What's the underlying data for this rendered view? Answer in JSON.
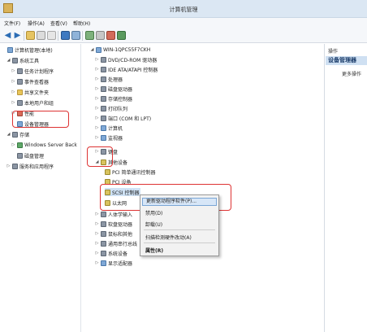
{
  "window": {
    "title": "计算机管理"
  },
  "menu": [
    "文件(F)",
    "操作(A)",
    "查看(V)",
    "帮助(H)"
  ],
  "left_tree": [
    {
      "label": "计算机管理(本地)",
      "icon": "computer-icon",
      "indent": 0,
      "arrow": ""
    },
    {
      "label": "系统工具",
      "icon": "tools-icon",
      "indent": 1,
      "arrow": "◢"
    },
    {
      "label": "任务计划程序",
      "icon": "clock-icon",
      "indent": 2,
      "arrow": "▷"
    },
    {
      "label": "事件查看器",
      "icon": "event-icon",
      "indent": 2,
      "arrow": "▷"
    },
    {
      "label": "共享文件夹",
      "icon": "folder-icon",
      "indent": 2,
      "arrow": "▷"
    },
    {
      "label": "本地用户和组",
      "icon": "users-icon",
      "indent": 2,
      "arrow": "▷"
    },
    {
      "label": "性能",
      "icon": "performance-icon",
      "indent": 2,
      "arrow": "▷"
    },
    {
      "label": "设备管理器",
      "icon": "device-manager-icon",
      "indent": 2,
      "arrow": ""
    },
    {
      "label": "存储",
      "icon": "storage-icon",
      "indent": 1,
      "arrow": "◢"
    },
    {
      "label": "Windows Server Back",
      "icon": "backup-icon",
      "indent": 2,
      "arrow": "▷"
    },
    {
      "label": "磁盘管理",
      "icon": "disk-icon",
      "indent": 2,
      "arrow": ""
    },
    {
      "label": "服务和应用程序",
      "icon": "services-icon",
      "indent": 1,
      "arrow": "▷"
    }
  ],
  "device_tree": [
    {
      "label": "WIN-1QPC55F7CKH",
      "icon": "computer-icon",
      "indent": 0,
      "arrow": "◢"
    },
    {
      "label": "DVD/CD-ROM 驱动器",
      "icon": "dvd-icon",
      "indent": 1,
      "arrow": "▷"
    },
    {
      "label": "IDE ATA/ATAPI 控制器",
      "icon": "ide-icon",
      "indent": 1,
      "arrow": "▷"
    },
    {
      "label": "处理器",
      "icon": "cpu-icon",
      "indent": 1,
      "arrow": "▷"
    },
    {
      "label": "磁盘驱动器",
      "icon": "disk-icon",
      "indent": 1,
      "arrow": "▷"
    },
    {
      "label": "存储控制器",
      "icon": "storage-controller-icon",
      "indent": 1,
      "arrow": "▷"
    },
    {
      "label": "打印队列",
      "icon": "printer-icon",
      "indent": 1,
      "arrow": "▷"
    },
    {
      "label": "端口 (COM 和 LPT)",
      "icon": "port-icon",
      "indent": 1,
      "arrow": "▷"
    },
    {
      "label": "计算机",
      "icon": "computer-icon",
      "indent": 1,
      "arrow": "▷"
    },
    {
      "label": "监视器",
      "icon": "monitor-icon",
      "indent": 1,
      "arrow": "▷"
    },
    {
      "label": "键盘",
      "icon": "keyboard-icon",
      "indent": 1,
      "arrow": "▷"
    },
    {
      "label": "其他设备",
      "icon": "other-devices-icon",
      "indent": 1,
      "arrow": "◢"
    },
    {
      "label": "PCI 简单通讯控制器",
      "icon": "warning-device-icon",
      "indent": 2,
      "arrow": ""
    },
    {
      "label": "PCI 设备",
      "icon": "warning-device-icon",
      "indent": 2,
      "arrow": ""
    },
    {
      "label": "SCSI 控制器",
      "icon": "warning-device-icon",
      "indent": 2,
      "arrow": ""
    },
    {
      "label": "以太网",
      "icon": "warning-device-icon",
      "indent": 2,
      "arrow": ""
    },
    {
      "label": "人体学输入",
      "icon": "hid-icon",
      "indent": 1,
      "arrow": "▷"
    },
    {
      "label": "软盘驱动器",
      "icon": "floppy-icon",
      "indent": 1,
      "arrow": "▷"
    },
    {
      "label": "鼠标和其他",
      "icon": "mouse-icon",
      "indent": 1,
      "arrow": "▷"
    },
    {
      "label": "通用串行总线",
      "icon": "usb-icon",
      "indent": 1,
      "arrow": "▷"
    },
    {
      "label": "系统设备",
      "icon": "system-icon",
      "indent": 1,
      "arrow": "▷"
    },
    {
      "label": "显示适配器",
      "icon": "display-icon",
      "indent": 1,
      "arrow": "▷"
    }
  ],
  "context_menu": [
    {
      "label": "更新驱动程序软件(P)...",
      "selected": true
    },
    {
      "label": "禁用(D)",
      "selected": false
    },
    {
      "label": "卸载(U)",
      "selected": false
    },
    {
      "label": "扫描检测硬件改动(A)",
      "selected": false
    },
    {
      "label": "属性(R)",
      "selected": false
    }
  ],
  "actions": {
    "header": "操作",
    "section": "设备管理器",
    "more": "更多操作"
  },
  "colors": {
    "highlight": "#dd3333",
    "accent": "#2c6db5",
    "selected_bg": "#d7e6f7"
  }
}
